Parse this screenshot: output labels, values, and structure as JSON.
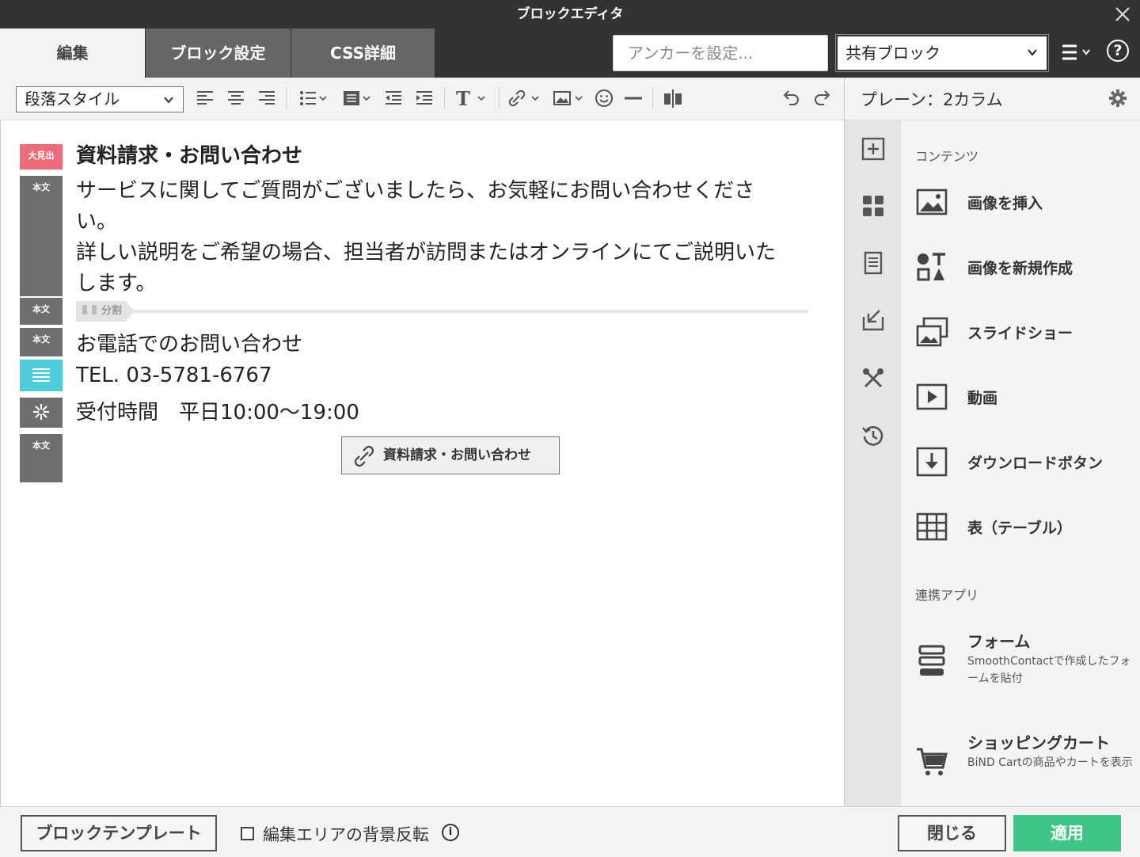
{
  "window": {
    "title": "ブロックエディタ"
  },
  "tabs": [
    {
      "label": "編集",
      "active": true
    },
    {
      "label": "ブロック設定",
      "active": false
    },
    {
      "label": "CSS詳細",
      "active": false
    }
  ],
  "anchor": {
    "placeholder": "アンカーを設定..."
  },
  "shared_block": {
    "value": "共有ブロック"
  },
  "toolbar": {
    "paragraph_style": "段落スタイル",
    "icons": [
      "align-left-icon",
      "align-center-icon",
      "align-right-icon",
      "bullet-list-icon",
      "block-format-icon",
      "outdent-icon",
      "indent-icon",
      "text-style-icon",
      "link-icon",
      "image-icon",
      "emoji-icon",
      "horizontal-rule-icon",
      "split-column-icon",
      "undo-icon",
      "redo-icon"
    ]
  },
  "right_header": {
    "title": "プレーン：2カラム"
  },
  "editor": {
    "blocks": [
      {
        "badge": "大見出",
        "text": "資料請求・お問い合わせ",
        "color": "#ec6c7a"
      },
      {
        "badge": "本文",
        "text": "サービスに関してご質問がございましたら、お気軽にお問い合わせくださ\nい。\n詳しい説明をご希望の場合、担当者が訪問またはオンラインにてご説明いた\nします。"
      },
      {
        "badge": "本文",
        "divider_label": "分割"
      },
      {
        "badge": "本文",
        "text": "お電話でのお問い合わせ"
      },
      {
        "badge_icon": "list-block-icon",
        "text": "TEL. 03-5781-6767",
        "color": "#4ecdd9"
      },
      {
        "badge_icon": "asterisk-icon",
        "text": "受付時間　平日10:00〜19:00"
      },
      {
        "badge": "本文",
        "button_label": "資料請求・お問い合わせ"
      }
    ]
  },
  "panel": {
    "contents_label": "コンテンツ",
    "items": [
      {
        "label": "画像を挿入",
        "icon": "insert-image-icon"
      },
      {
        "label": "画像を新規作成",
        "icon": "create-image-icon"
      },
      {
        "label": "スライドショー",
        "icon": "slideshow-icon"
      },
      {
        "label": "動画",
        "icon": "video-icon"
      },
      {
        "label": "ダウンロードボタン",
        "icon": "download-icon"
      },
      {
        "label": "表（テーブル）",
        "icon": "table-icon"
      }
    ],
    "apps_label": "連携アプリ",
    "apps": [
      {
        "label": "フォーム",
        "desc": "SmoothContactで作成したフォームを貼付",
        "icon": "form-icon"
      },
      {
        "label": "ショッピングカート",
        "desc": "BiND Cartの商品やカートを表示",
        "icon": "cart-icon"
      }
    ]
  },
  "footer": {
    "template_button": "ブロックテンプレート",
    "invert_checkbox": "編集エリアの背景反転",
    "close_button": "閉じる",
    "apply_button": "適用"
  }
}
